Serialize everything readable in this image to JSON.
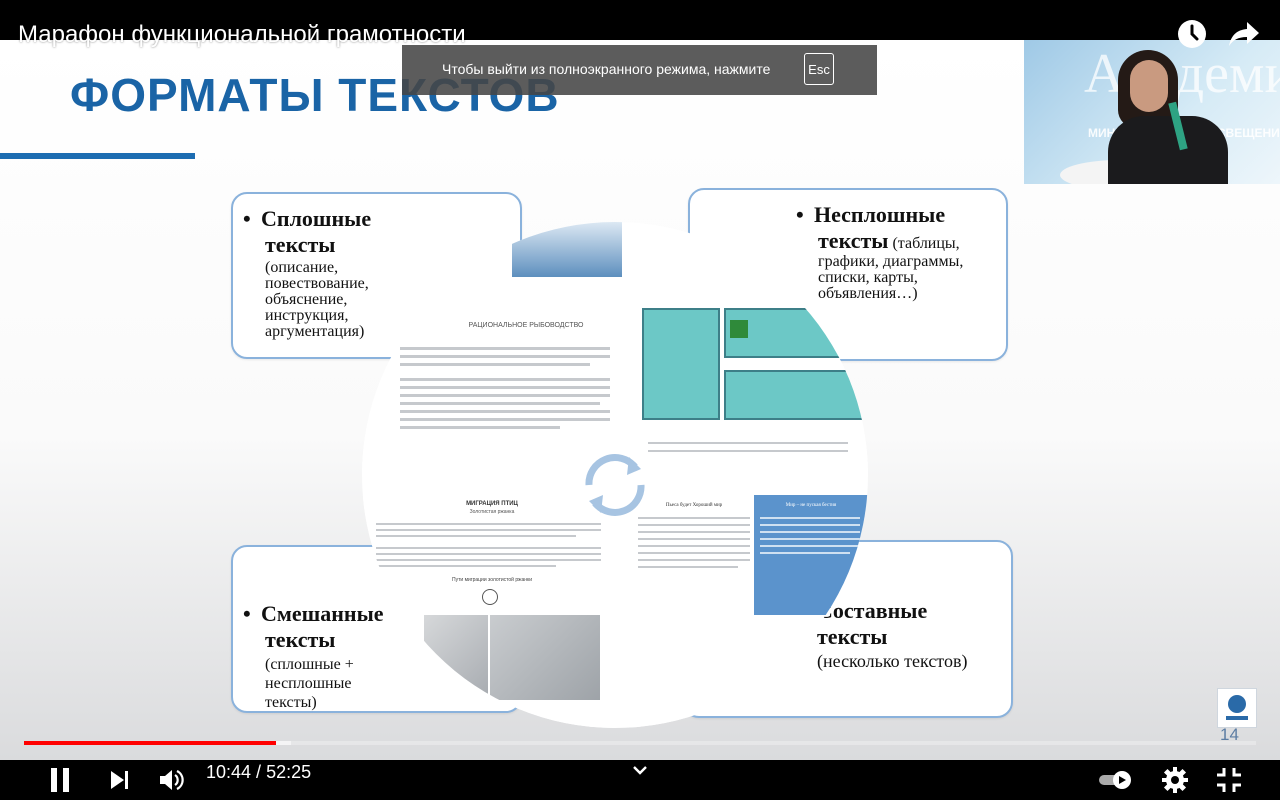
{
  "player": {
    "video_title": "Марафон функциональной грамотности",
    "time_current": "10:44",
    "time_separator": " / ",
    "time_total": "52:25",
    "progress_played": 0.2047,
    "progress_loaded": 0.217,
    "accent_color": "#ff0000",
    "icons": [
      "watch-later-icon",
      "share-icon",
      "pause-icon",
      "next-icon",
      "volume-icon",
      "chevron-down-icon",
      "autoplay-toggle-icon",
      "settings-icon",
      "exit-fullscreen-icon"
    ]
  },
  "fullscreen_notice": {
    "text": "Чтобы выйти из полноэкранного режима, нажмите",
    "key": "Esc"
  },
  "webcam": {
    "background_text": "АкадемиЯ",
    "ticker_text": "МИНИСТЕРСТВА ПРОСВЕЩЕНИЯ РОССИИ"
  },
  "slide": {
    "title": "ФОРМАТЫ ТЕКСТОВ",
    "title_color": "#1a64a6",
    "page_number": "14",
    "boxes": {
      "continuous": {
        "bullet": "•",
        "head_line1": "Сплошные",
        "head_line2": "тексты",
        "sub_lines": [
          "(описание,",
          "повествование,",
          "объяснение,",
          "инструкция,",
          "аргументация)"
        ]
      },
      "noncontinuous": {
        "bullet": "•",
        "head_line1": "Несплошные",
        "head_line2": "тексты",
        "sub_inline": "(таблицы,",
        "sub_lines": [
          "графики, диаграммы,",
          "списки, карты,",
          "объявления…)"
        ]
      },
      "mixed": {
        "bullet": "•",
        "head_line1": "Смешанные",
        "head_line2": "тексты",
        "sub_lines": [
          "(сплошные +",
          "несплошные",
          "тексты)"
        ]
      },
      "multiple": {
        "head_line1": "Составные",
        "head_line2": "тексты",
        "sub_lines": [
          "(несколько текстов)"
        ]
      }
    },
    "collage": {
      "doc1_title": "РАЦИОНАЛЬНОЕ РЫБОВОДСТВО",
      "doc3_title": "МИГРАЦИЯ ПТИЦ",
      "doc3_subtitle": "Золотистая ржанка",
      "doc3_map_caption": "Пути миграции золотистой ржанки",
      "doc4_left_title": "Пьеса будет Хороший мир",
      "doc4_right_title": "Мир – не пуская бестия"
    }
  }
}
